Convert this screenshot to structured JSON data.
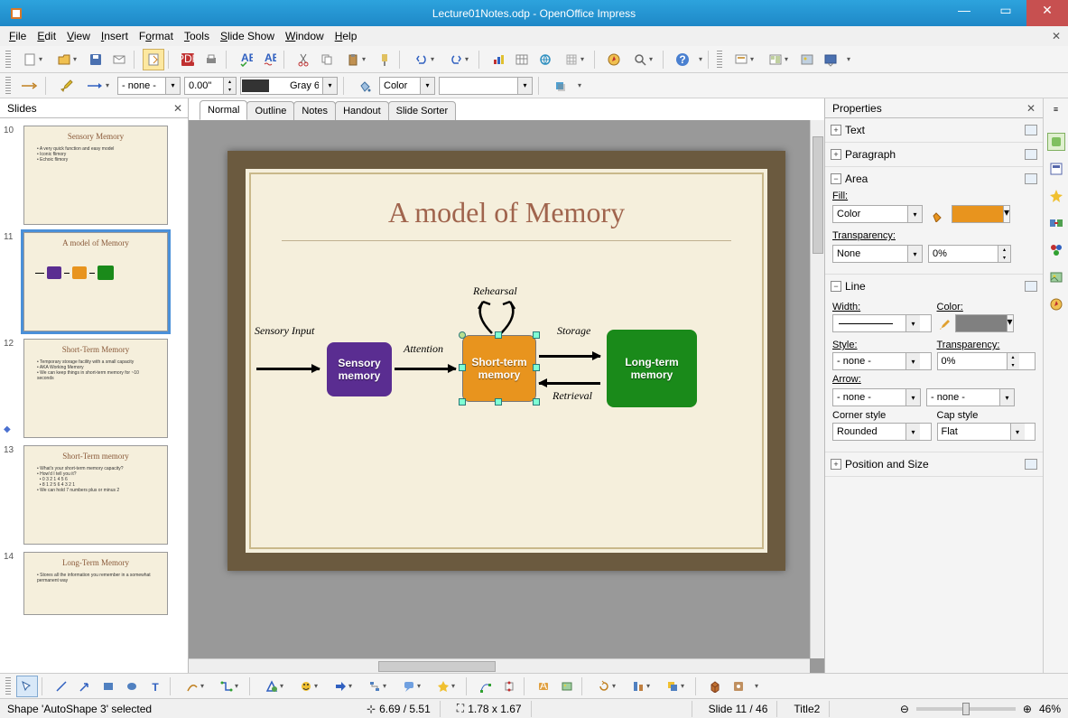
{
  "title": "Lecture01Notes.odp - OpenOffice Impress",
  "menu": [
    "File",
    "Edit",
    "View",
    "Insert",
    "Format",
    "Tools",
    "Slide Show",
    "Window",
    "Help"
  ],
  "toolbar2": {
    "line_style": "- none -",
    "line_width": "0.00\"",
    "color_label": "Gray 6",
    "color_mode": "Color"
  },
  "slides_panel": {
    "title": "Slides",
    "items": [
      {
        "num": "10",
        "title": "Sensory Memory"
      },
      {
        "num": "11",
        "title": "A model of Memory",
        "selected": true
      },
      {
        "num": "12",
        "title": "Short-Term Memory"
      },
      {
        "num": "13",
        "title": "Short-Term memory"
      },
      {
        "num": "14",
        "title": "Long-Term Memory"
      }
    ]
  },
  "view_tabs": [
    "Normal",
    "Outline",
    "Notes",
    "Handout",
    "Slide Sorter"
  ],
  "slide": {
    "title": "A model of Memory",
    "labels": {
      "sensory_input": "Sensory Input",
      "attention": "Attention",
      "rehearsal": "Rehearsal",
      "storage": "Storage",
      "retrieval": "Retrieval"
    },
    "boxes": {
      "sensory": "Sensory\nmemory",
      "short": "Short-term\nmemory",
      "long": "Long-term\nmemory"
    }
  },
  "properties": {
    "title": "Properties",
    "sections": {
      "text": "Text",
      "paragraph": "Paragraph",
      "area": "Area",
      "line": "Line",
      "pos": "Position and Size"
    },
    "area": {
      "fill_label": "Fill:",
      "fill_mode": "Color",
      "fill_color": "#e8941e",
      "trans_label": "Transparency:",
      "trans_mode": "None",
      "trans_val": "0%"
    },
    "line": {
      "width_label": "Width:",
      "width": "",
      "color_label": "Color:",
      "color": "#808080",
      "style_label": "Style:",
      "style": "- none -",
      "trans_label": "Transparency:",
      "trans": "0%",
      "arrow_label": "Arrow:",
      "arrow1": "- none -",
      "arrow2": "- none -",
      "corner_label": "Corner style",
      "corner": "Rounded",
      "cap_label": "Cap style",
      "cap": "Flat"
    }
  },
  "status": {
    "shape": "Shape 'AutoShape 3' selected",
    "pos": "6.69 / 5.51",
    "size": "1.78 x 1.67",
    "slide": "Slide 11 / 46",
    "master": "Title2",
    "zoom": "46%"
  }
}
